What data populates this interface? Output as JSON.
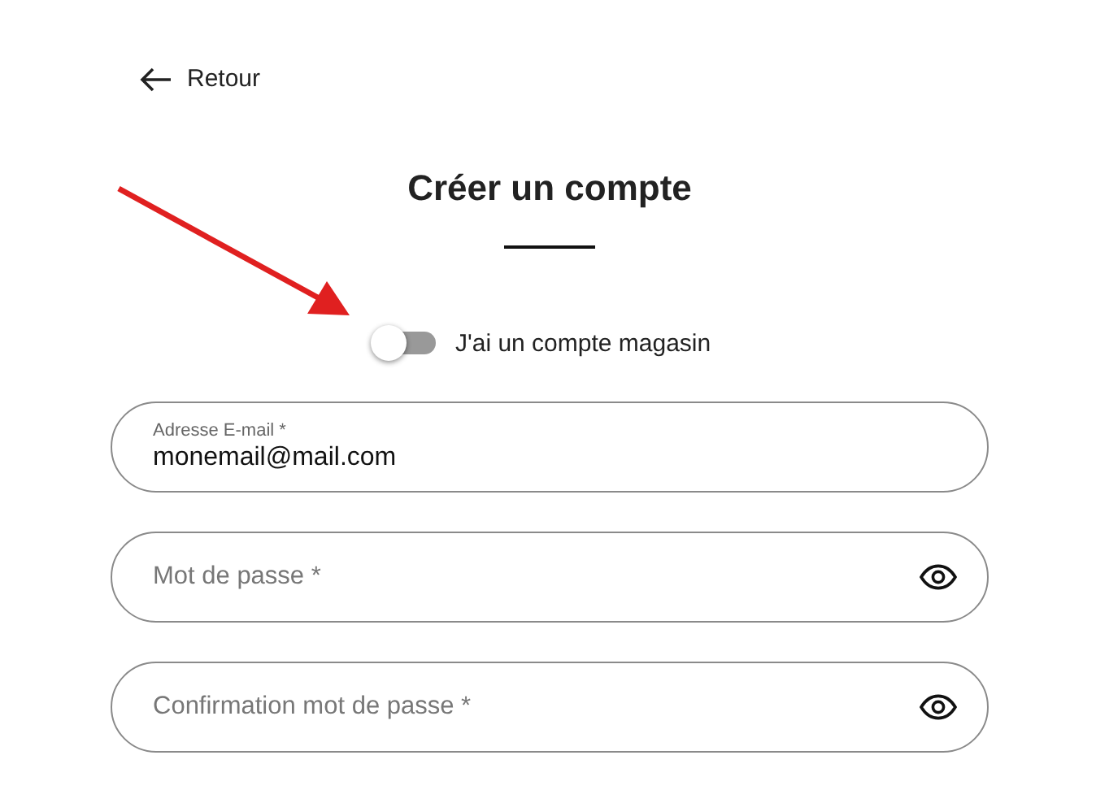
{
  "back": {
    "label": "Retour"
  },
  "title": "Créer un compte",
  "toggle": {
    "label": "J'ai un compte magasin",
    "on": false
  },
  "fields": [
    {
      "kind": "text",
      "label": "Adresse E-mail *",
      "value": "monemail@mail.com"
    },
    {
      "kind": "password",
      "placeholder": "Mot de passe *"
    },
    {
      "kind": "password",
      "placeholder": "Confirmation mot de passe *"
    }
  ],
  "annotation": {
    "kind": "arrow"
  }
}
